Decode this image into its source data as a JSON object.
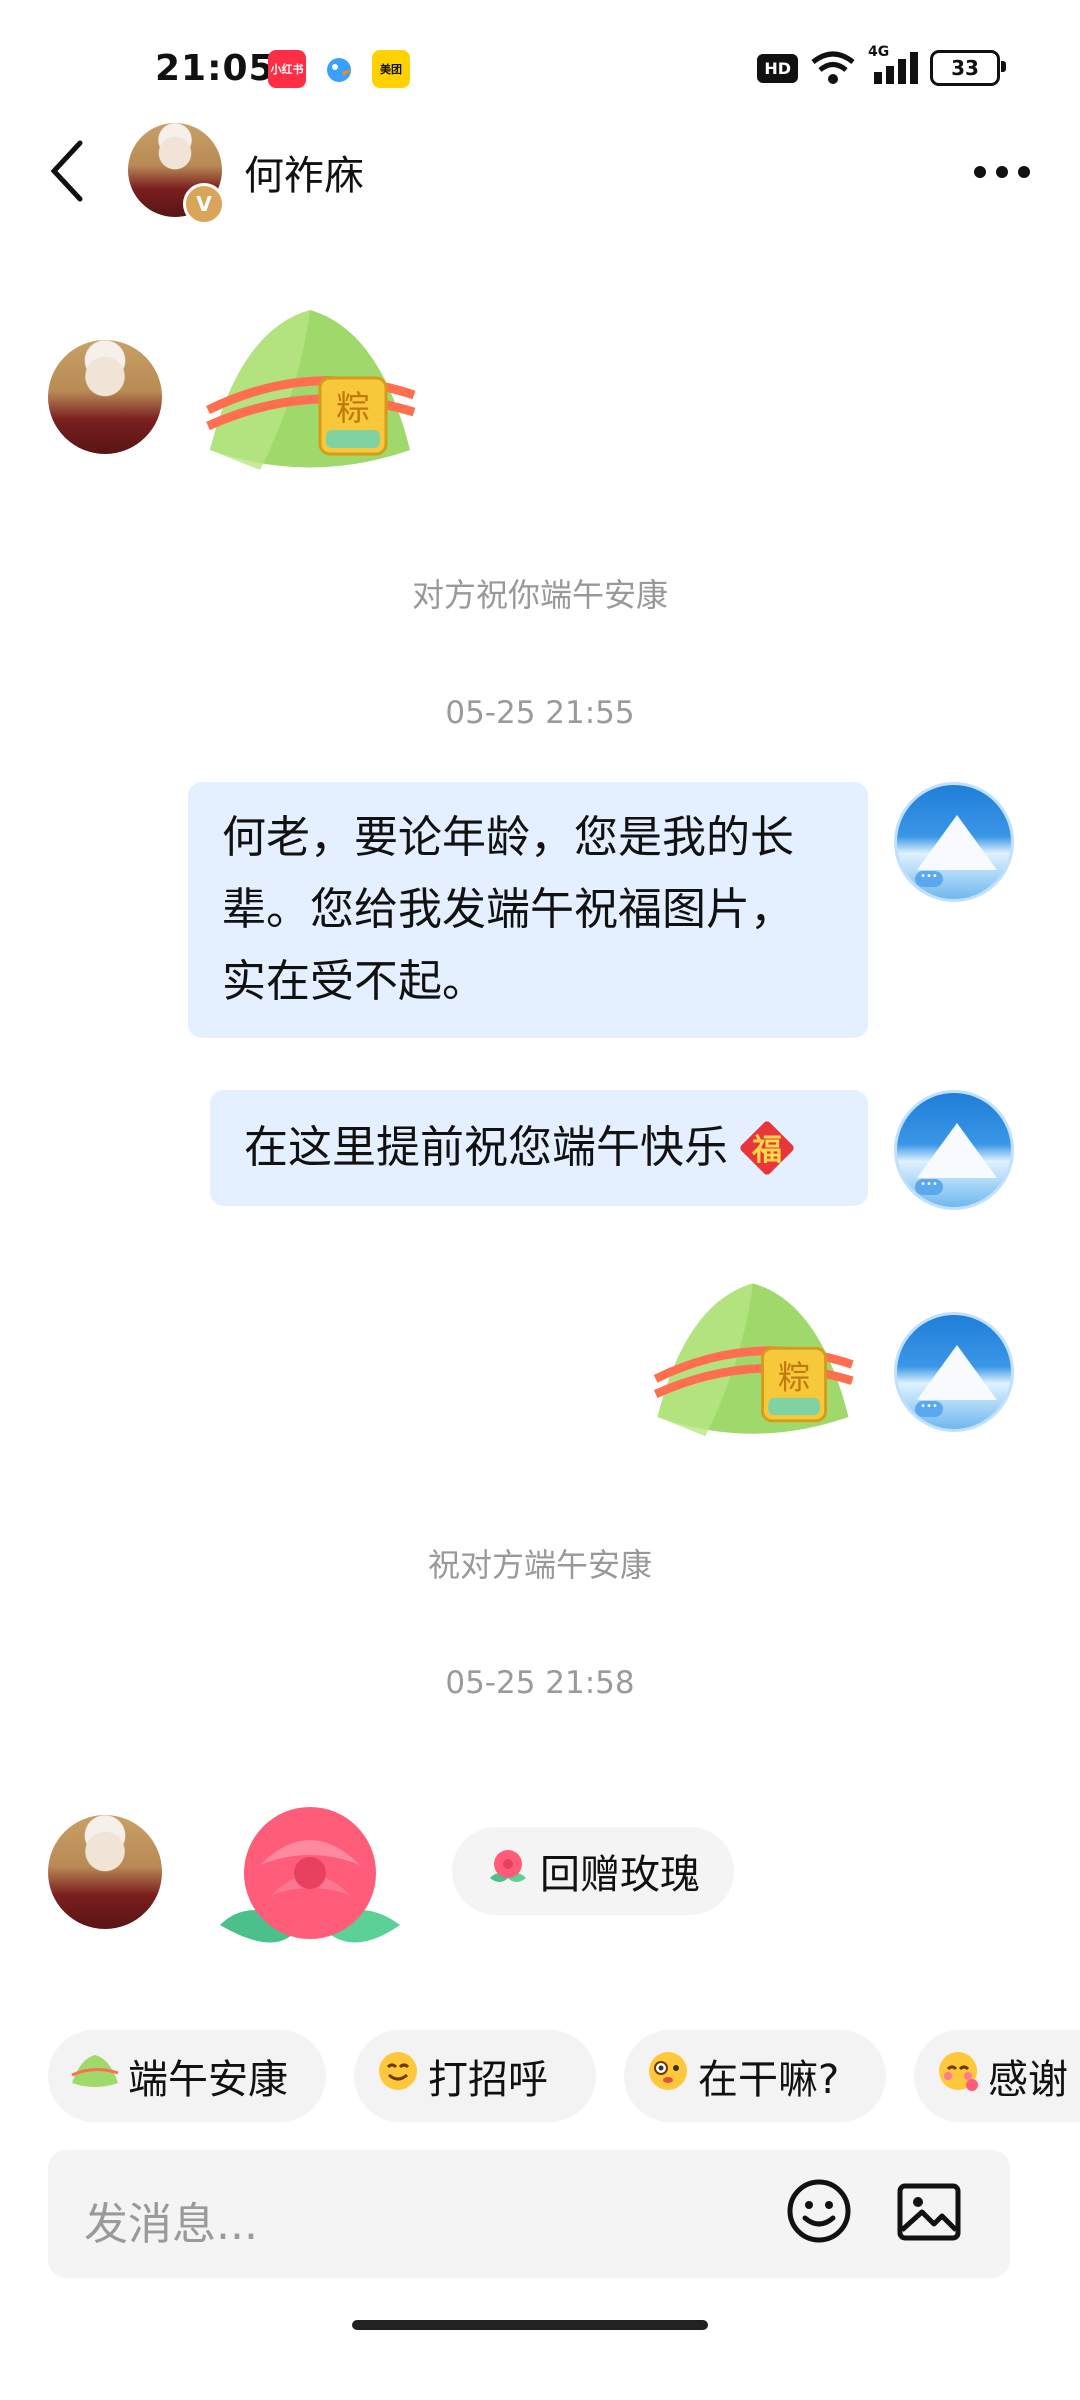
{
  "status_bar": {
    "time": "21:05",
    "apps": [
      "小红书",
      "",
      "美团"
    ],
    "network": "4G",
    "battery": "33"
  },
  "header": {
    "contact_name": "何祚庥",
    "badge": "V"
  },
  "messages": {
    "system_1": "对方祝你端午安康",
    "timestamp_1": "05-25 21:55",
    "bubble_1": "何老，要论年龄，您是我的长辈。您给我发端午祝福图片，实在受不起。",
    "bubble_2": "在这里提前祝您端午快乐",
    "bubble_2_emoji": "福",
    "system_2": "祝对方端午安康",
    "timestamp_2": "05-25 21:58",
    "zongzi_tag": "粽"
  },
  "gift_chip": {
    "label": "回赠玫瑰"
  },
  "quick_replies": [
    {
      "label": "端午安康"
    },
    {
      "label": "打招呼"
    },
    {
      "label": "在干嘛?"
    },
    {
      "label": "感谢"
    }
  ],
  "input": {
    "placeholder": "发消息..."
  }
}
